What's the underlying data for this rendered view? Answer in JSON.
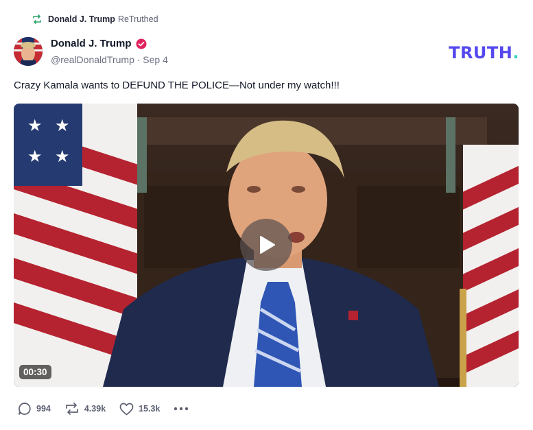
{
  "retruth": {
    "author": "Donald J. Trump",
    "label": "ReTruthed",
    "icon": "retruth-icon"
  },
  "post": {
    "author_name": "Donald J. Trump",
    "verified_icon": "verified-badge-icon",
    "handle_line": "@realDonaldTrump · Sep 4",
    "text": "Crazy Kamala wants to DEFUND THE POLICE—Not under my watch!!!"
  },
  "brand": {
    "word": "TRUTH",
    "dot": "."
  },
  "video": {
    "duration": "00:30",
    "play_icon": "play-icon"
  },
  "actions": {
    "replies": "994",
    "retruths": "4.39k",
    "likes": "15.3k",
    "more_icon": "more-icon"
  },
  "colors": {
    "brand": "#5448ee",
    "brand_dot": "#33d3c0",
    "verified": "#e0245e",
    "retruth_green": "#2ea36b"
  }
}
